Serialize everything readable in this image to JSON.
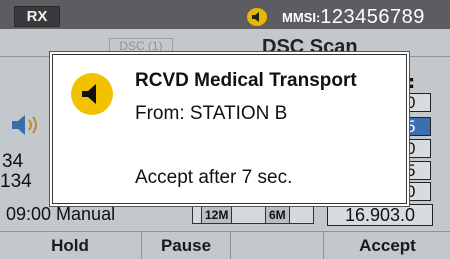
{
  "status_bar": {
    "rx_label": "RX",
    "mmsi_label": "MMSI:",
    "mmsi_value": "123456789"
  },
  "background": {
    "dsc_count": "DSC (1)",
    "title": "DSC Scan",
    "channels": [
      "34",
      "134"
    ],
    "right_values": [
      "0",
      "5",
      "0",
      "5",
      "0"
    ],
    "time_mode": "09:00 Manual",
    "range_low": "12M",
    "range_high": "6M",
    "frequency": "16.903.0"
  },
  "dialog": {
    "icon": "speaker-icon",
    "title": "RCVD Medical Transport",
    "from": "From: STATION B",
    "accept_timer": "Accept after 7 sec."
  },
  "softkeys": [
    "Hold",
    "Pause",
    "",
    "Accept"
  ],
  "colors": {
    "status_bar": "#5d5d61",
    "screen_bg": "#c3c8cc",
    "icon_yellow": "#f2c200",
    "highlight_blue": "#3d6fb0"
  }
}
